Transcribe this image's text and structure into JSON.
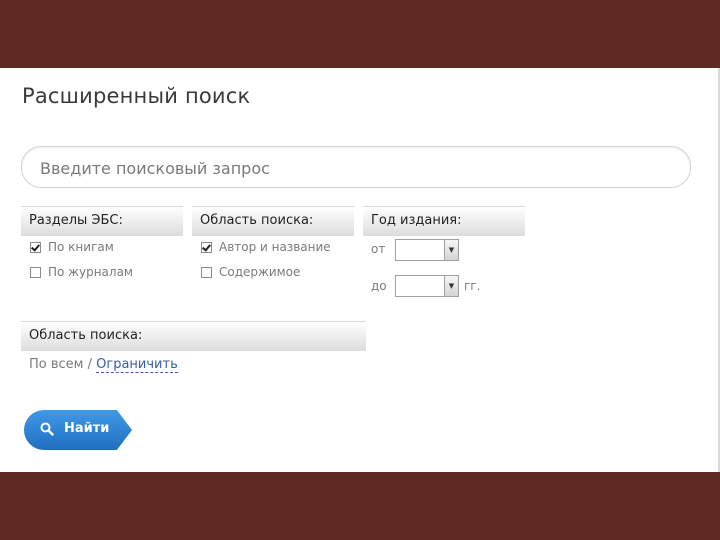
{
  "page_title": "Расширенный поиск",
  "search": {
    "placeholder": "Введите поисковый запрос"
  },
  "sections": {
    "ebs": {
      "heading": "Разделы ЭБС:",
      "options": [
        {
          "label": "По книгам",
          "checked": true
        },
        {
          "label": "По журналам",
          "checked": false
        }
      ]
    },
    "area": {
      "heading": "Область поиска:",
      "options": [
        {
          "label": "Автор и название",
          "checked": true
        },
        {
          "label": "Содержимое",
          "checked": false
        }
      ]
    },
    "year": {
      "heading": "Год издания:",
      "from_label": "от",
      "to_label": "до",
      "suffix": "гг.",
      "from_value": "",
      "to_value": ""
    },
    "scope": {
      "heading": "Область поиска:",
      "all_label": "По всем",
      "separator": " / ",
      "limit_link": "Ограничить"
    }
  },
  "find_button": {
    "label": "Найти",
    "icon": "search-icon"
  },
  "colors": {
    "frame": "#5e2a23",
    "button": "#2a82d6",
    "link": "#3b5ea0"
  }
}
